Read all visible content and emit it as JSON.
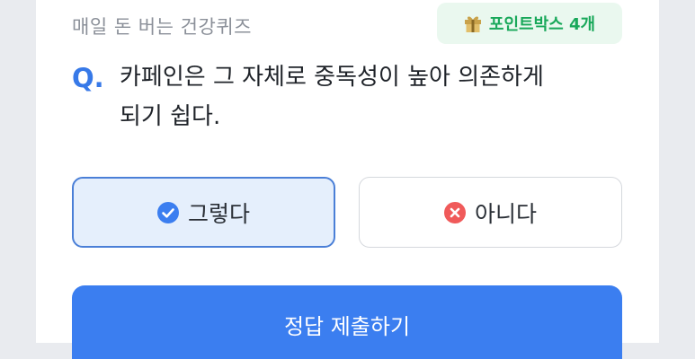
{
  "header": {
    "title": "매일 돈 버는 건강퀴즈",
    "badge_label": "포인트박스 4개"
  },
  "quiz": {
    "q_mark": "Q.",
    "question_line1": "카페인은 그 자체로 중독성이 높아 의존하게",
    "question_line2": "되기 쉽다."
  },
  "answers": [
    {
      "label": "그렇다",
      "icon": "check-circle-icon",
      "selected": true
    },
    {
      "label": "아니다",
      "icon": "x-circle-icon",
      "selected": false
    }
  ],
  "submit_label": "정답 제출하기",
  "colors": {
    "accent": "#3b7ef0",
    "badge_green": "#19a85a",
    "badge_bg": "#eaf8ef",
    "wrong_red": "#f05a5a"
  }
}
